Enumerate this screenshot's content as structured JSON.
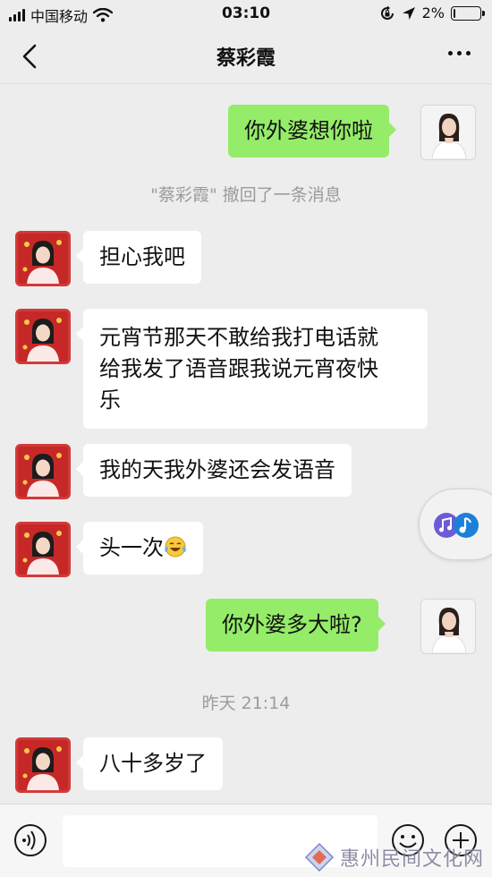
{
  "status_bar": {
    "carrier": "中国移动",
    "time": "03:10",
    "battery": "2%",
    "battery_level": 0.02
  },
  "header": {
    "title": "蔡彩霞"
  },
  "messages": [
    {
      "side": "right",
      "text": "你外婆想你啦"
    },
    {
      "type": "system",
      "text": "\"蔡彩霞\" 撤回了一条消息"
    },
    {
      "side": "left",
      "text": "担心我吧"
    },
    {
      "side": "left",
      "lines": [
        "元宵节那天不敢给我打电话就",
        "给我发了语音跟我说元宵夜快",
        "乐"
      ]
    },
    {
      "side": "left",
      "text": "我的天我外婆还会发语音"
    },
    {
      "side": "left",
      "text": "头一次",
      "emoji": "tears-of-joy-emoji"
    },
    {
      "side": "right",
      "text": "你外婆多大啦?"
    },
    {
      "type": "timestamp",
      "text": "昨天 21:14"
    },
    {
      "side": "left",
      "text": "八十多岁了"
    }
  ],
  "input_bar": {
    "voice_icon": "voice-icon",
    "emoji_icon": "emoji-icon",
    "add_icon": "plus-circle-icon",
    "placeholder": ""
  },
  "watermark": {
    "text": "惠州民间文化网"
  },
  "colors": {
    "background": "#ededed",
    "bubble_self": "#95ec69",
    "bubble_other": "#ffffff",
    "system_text": "#9b9b9b"
  }
}
